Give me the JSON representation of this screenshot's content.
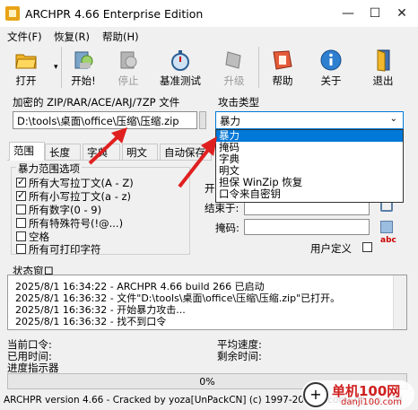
{
  "window": {
    "title": "ARCHPR 4.66 Enterprise Edition",
    "min": "—",
    "max": "☐",
    "close": "✕"
  },
  "menu": [
    "文件(F)",
    "恢复(R)",
    "帮助(H)"
  ],
  "toolbar": [
    {
      "label": "打开",
      "icon": "folder-open-icon",
      "enabled": true
    },
    {
      "label": "开始!",
      "icon": "run-icon",
      "enabled": true
    },
    {
      "label": "停止",
      "icon": "stop-icon",
      "enabled": false
    },
    {
      "label": "基准测试",
      "icon": "stopwatch-icon",
      "enabled": true
    },
    {
      "label": "升级",
      "icon": "upgrade-icon",
      "enabled": false
    },
    {
      "label": "帮助",
      "icon": "help-icon",
      "enabled": true
    },
    {
      "label": "关于",
      "icon": "info-icon",
      "enabled": true
    },
    {
      "label": "退出",
      "icon": "exit-door-icon",
      "enabled": true
    }
  ],
  "archive": {
    "label": "加密的 ZIP/RAR/ACE/ARJ/7ZP 文件",
    "path": "D:\\tools\\桌面\\office\\压缩\\压缩.zip"
  },
  "attack": {
    "label": "攻击类型",
    "selected": "暴力",
    "options": [
      "暴力",
      "掩码",
      "字典",
      "明文",
      "担保 WinZip 恢复",
      "口令来自密钥"
    ]
  },
  "tabs": [
    "范围",
    "长度",
    "字典",
    "明文",
    "自动保存"
  ],
  "range": {
    "group_label": "暴力范围选项",
    "options": [
      {
        "label": "所有大写拉丁文(A - Z)",
        "checked": true
      },
      {
        "label": "所有小写拉丁文(a - z)",
        "checked": true
      },
      {
        "label": "所有数字(0 - 9)",
        "checked": false
      },
      {
        "label": "所有特殊符号(!@...)",
        "checked": false
      },
      {
        "label": "空格",
        "checked": false
      },
      {
        "label": "所有可打印字符",
        "checked": false
      }
    ]
  },
  "right_panel": {
    "start_partial": "开",
    "end_label": "结束于:",
    "mask_label": "掩码:",
    "custom_label": "用户定义",
    "abc_icon_text": "abc"
  },
  "status": {
    "label": "状态窗口",
    "lines": [
      "2025/8/1 16:34:22 - ARCHPR 4.66 build 266 已启动",
      "2025/8/1 16:36:32 - 文件\"D:\\tools\\桌面\\office\\压缩\\压缩.zip\"已打开。",
      "2025/8/1 16:36:32 - 开始暴力攻击...",
      "2025/8/1 16:36:32 - 找不到口令"
    ]
  },
  "info": {
    "current_password": "当前口令:",
    "elapsed": "已用时间:",
    "progress_label": "进度指示器",
    "avg_speed": "平均速度:",
    "remaining": "剩余时间:"
  },
  "progress": {
    "text": "0%",
    "value": 0
  },
  "footer": {
    "text": "ARCHPR version 4.66 - Cracked by yoza[UnPackCN] (c) 1997-2023 ElcomSoft Co. Ltd",
    "watermark": "单机100网",
    "watermark_url": "danji100.com"
  }
}
